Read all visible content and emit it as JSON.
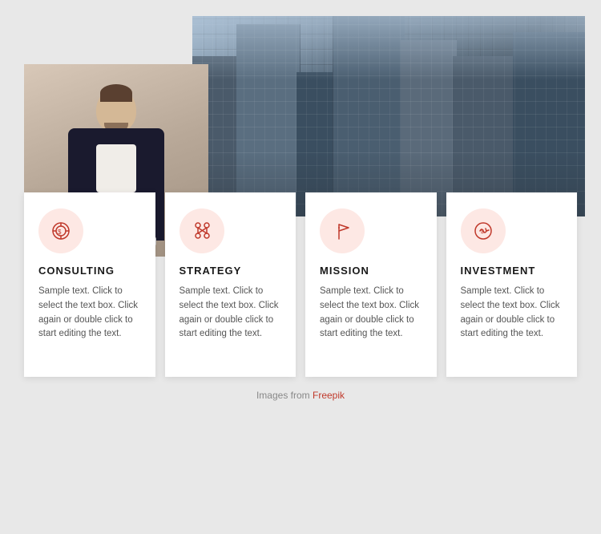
{
  "images": {
    "person_alt": "Business person working on laptop",
    "buildings_alt": "City buildings skyscrapers"
  },
  "cards": [
    {
      "id": "consulting",
      "title": "CONSULTING",
      "icon": "consulting-icon",
      "text": "Sample text. Click to select the text box. Click again or double click to start editing the text."
    },
    {
      "id": "strategy",
      "title": "STRATEGY",
      "icon": "strategy-icon",
      "text": "Sample text. Click to select the text box. Click again or double click to start editing the text."
    },
    {
      "id": "mission",
      "title": "MISSION",
      "icon": "mission-icon",
      "text": "Sample text. Click to select the text box. Click again or double click to start editing the text."
    },
    {
      "id": "investment",
      "title": "INVESTMENT",
      "icon": "investment-icon",
      "text": "Sample text. Click to select the text box. Click again or double click to start editing the text."
    }
  ],
  "footer": {
    "text": "Images from ",
    "link_label": "Freepik",
    "link_url": "#"
  }
}
